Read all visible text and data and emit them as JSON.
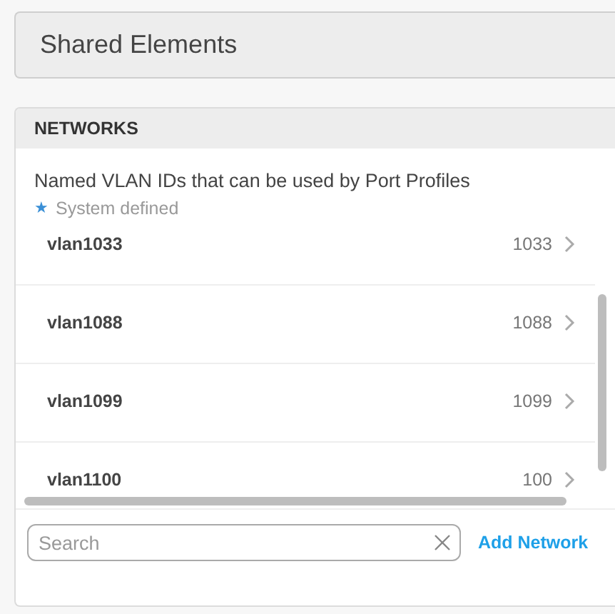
{
  "header": {
    "title": "Shared Elements"
  },
  "networks_panel": {
    "title": "NETWORKS",
    "description": "Named VLAN IDs that can be used by Port Profiles",
    "legend": {
      "symbol": "★",
      "label": "System defined"
    },
    "rows": [
      {
        "name": "vlan1033",
        "vlan_id": "1033"
      },
      {
        "name": "vlan1088",
        "vlan_id": "1088"
      },
      {
        "name": "vlan1099",
        "vlan_id": "1099"
      },
      {
        "name": "vlan1100",
        "vlan_id": "100"
      }
    ],
    "search": {
      "placeholder": "Search"
    },
    "add_button": "Add Network"
  }
}
